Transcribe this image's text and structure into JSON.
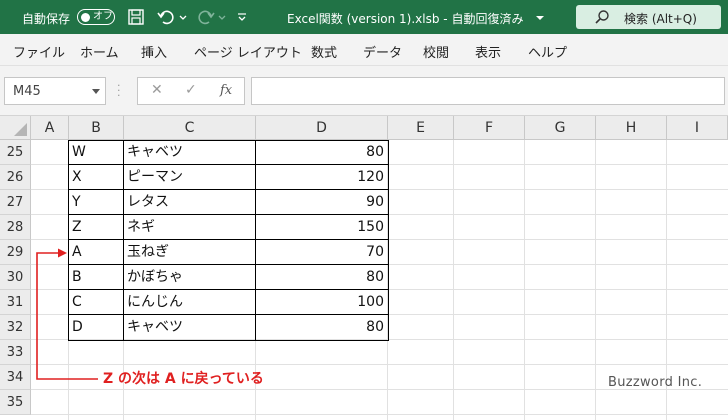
{
  "titlebar": {
    "autosave_label": "自動保存",
    "autosave_state": "オフ",
    "document_title": "Excel関数 (version 1).xlsb  -  自動回復済み",
    "search_label": "検索 (Alt+Q)",
    "background_color": "#217346"
  },
  "menu": {
    "items": [
      "ファイル",
      "ホーム",
      "挿入",
      "ページ レイアウト",
      "数式",
      "データ",
      "校閲",
      "表示",
      "ヘルプ"
    ]
  },
  "formula_bar": {
    "name_box": "M45",
    "fx_label": "fx",
    "formula": ""
  },
  "grid": {
    "columns": [
      "A",
      "B",
      "C",
      "D",
      "E",
      "F",
      "G",
      "H",
      "I"
    ],
    "rows": [
      {
        "num": "25",
        "b": "W",
        "c": "キャベツ",
        "d": "80"
      },
      {
        "num": "26",
        "b": "X",
        "c": "ピーマン",
        "d": "120"
      },
      {
        "num": "27",
        "b": "Y",
        "c": "レタス",
        "d": "90"
      },
      {
        "num": "28",
        "b": "Z",
        "c": "ネギ",
        "d": "150"
      },
      {
        "num": "29",
        "b": "A",
        "c": "玉ねぎ",
        "d": "70"
      },
      {
        "num": "30",
        "b": "B",
        "c": "かぼちゃ",
        "d": "80"
      },
      {
        "num": "31",
        "b": "C",
        "c": "にんじん",
        "d": "100"
      },
      {
        "num": "32",
        "b": "D",
        "c": "キャベツ",
        "d": "80"
      },
      {
        "num": "33",
        "b": "",
        "c": "",
        "d": ""
      },
      {
        "num": "34",
        "b": "",
        "c": "",
        "d": ""
      },
      {
        "num": "35",
        "b": "",
        "c": "",
        "d": ""
      }
    ]
  },
  "annotation": {
    "text": "Z の次は A に戻っている",
    "color": "#e02020"
  },
  "watermark": "Buzzword Inc."
}
